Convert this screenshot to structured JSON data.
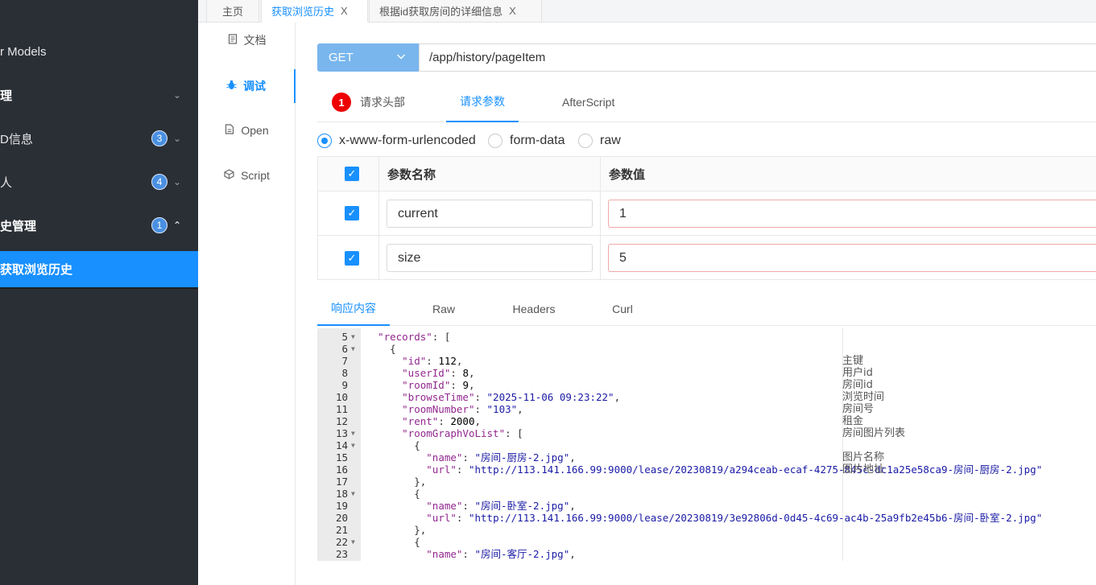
{
  "sidebar": {
    "items": [
      {
        "label": "r Models",
        "badge": "",
        "chevron": ""
      },
      {
        "label": "理",
        "badge": "",
        "chevron": "⌄"
      },
      {
        "label": "D信息",
        "badge": "3",
        "chevron": "⌄"
      },
      {
        "label": "人",
        "badge": "4",
        "chevron": "⌄"
      },
      {
        "label": "史管理",
        "badge": "1",
        "chevron": "⌃"
      },
      {
        "label": "获取浏览历史",
        "badge": "",
        "chevron": ""
      }
    ]
  },
  "top_tabs": [
    {
      "label": "主页",
      "closable": false
    },
    {
      "label": "获取浏览历史",
      "closable": true
    },
    {
      "label": "根据id获取房间的详细信息",
      "closable": true
    }
  ],
  "close_glyph": "X",
  "vnav": [
    {
      "label": "文档",
      "icon": "doc-icon"
    },
    {
      "label": "调试",
      "icon": "bug-icon"
    },
    {
      "label": "Open",
      "icon": "file-icon"
    },
    {
      "label": "Script",
      "icon": "code-icon"
    }
  ],
  "request": {
    "method": "GET",
    "url": "/app/history/pageItem"
  },
  "request_tabs": [
    {
      "label": "请求头部",
      "badge": "1"
    },
    {
      "label": "请求参数",
      "badge": ""
    },
    {
      "label": "AfterScript",
      "badge": ""
    }
  ],
  "body_types": [
    "x-www-form-urlencoded",
    "form-data",
    "raw"
  ],
  "params": {
    "headers": {
      "name": "参数名称",
      "value": "参数值"
    },
    "rows": [
      {
        "name": "current",
        "value": "1"
      },
      {
        "name": "size",
        "value": "5"
      }
    ]
  },
  "response_tabs": [
    "响应内容",
    "Raw",
    "Headers",
    "Curl"
  ],
  "code_lines": [
    {
      "n": "5",
      "fold": true,
      "html": "  <span class='k'>\"records\"</span>: [",
      "cmt": ""
    },
    {
      "n": "6",
      "fold": true,
      "html": "    {",
      "cmt": ""
    },
    {
      "n": "7",
      "fold": false,
      "html": "      <span class='k'>\"id\"</span>: <span class='n'>112</span>,",
      "cmt": "主键"
    },
    {
      "n": "8",
      "fold": false,
      "html": "      <span class='k'>\"userId\"</span>: <span class='n'>8</span>,",
      "cmt": "用户id"
    },
    {
      "n": "9",
      "fold": false,
      "html": "      <span class='k'>\"roomId\"</span>: <span class='n'>9</span>,",
      "cmt": "房间id"
    },
    {
      "n": "10",
      "fold": false,
      "html": "      <span class='k'>\"browseTime\"</span>: <span class='s'>\"2025-11-06 09:23:22\"</span>,",
      "cmt": "浏览时间"
    },
    {
      "n": "11",
      "fold": false,
      "html": "      <span class='k'>\"roomNumber\"</span>: <span class='s'>\"103\"</span>,",
      "cmt": "房间号"
    },
    {
      "n": "12",
      "fold": false,
      "html": "      <span class='k'>\"rent\"</span>: <span class='n'>2000</span>,",
      "cmt": "租金"
    },
    {
      "n": "13",
      "fold": true,
      "html": "      <span class='k'>\"roomGraphVoList\"</span>: [",
      "cmt": "房间图片列表"
    },
    {
      "n": "14",
      "fold": true,
      "html": "        {",
      "cmt": ""
    },
    {
      "n": "15",
      "fold": false,
      "html": "          <span class='k'>\"name\"</span>: <span class='s'>\"房间-厨房-2.jpg\"</span>,",
      "cmt": "图片名称"
    },
    {
      "n": "16",
      "fold": false,
      "html": "          <span class='k'>\"url\"</span>: <span class='s'>\"http://113.141.166.99:9000/lease/20230819/a294ceab-ecaf-4275-845c-dc1a25e58ca9-房间-厨房-2.jpg\"</span>",
      "cmt": "图片地址"
    },
    {
      "n": "17",
      "fold": false,
      "html": "        },",
      "cmt": ""
    },
    {
      "n": "18",
      "fold": true,
      "html": "        {",
      "cmt": ""
    },
    {
      "n": "19",
      "fold": false,
      "html": "          <span class='k'>\"name\"</span>: <span class='s'>\"房间-卧室-2.jpg\"</span>,",
      "cmt": ""
    },
    {
      "n": "20",
      "fold": false,
      "html": "          <span class='k'>\"url\"</span>: <span class='s'>\"http://113.141.166.99:9000/lease/20230819/3e92806d-0d45-4c69-ac4b-25a9fb2e45b6-房间-卧室-2.jpg\"</span>",
      "cmt": ""
    },
    {
      "n": "21",
      "fold": false,
      "html": "        },",
      "cmt": ""
    },
    {
      "n": "22",
      "fold": true,
      "html": "        {",
      "cmt": ""
    },
    {
      "n": "23",
      "fold": false,
      "html": "          <span class='k'>\"name\"</span>: <span class='s'>\"房间-客厅-2.jpg\"</span>,",
      "cmt": ""
    }
  ]
}
